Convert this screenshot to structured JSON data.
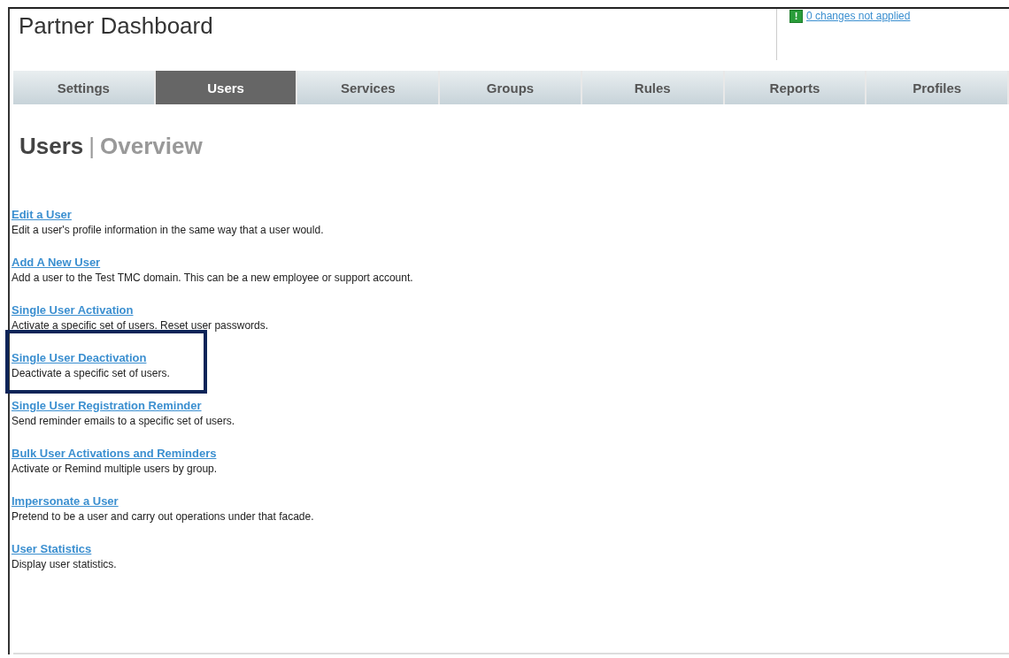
{
  "header": {
    "title": "Partner Dashboard",
    "changes_link": "0 changes not applied",
    "warning_icon": "!"
  },
  "tabs": [
    {
      "label": "Settings",
      "selected": false
    },
    {
      "label": "Users",
      "selected": true
    },
    {
      "label": "Services",
      "selected": false
    },
    {
      "label": "Groups",
      "selected": false
    },
    {
      "label": "Rules",
      "selected": false
    },
    {
      "label": "Reports",
      "selected": false
    },
    {
      "label": "Profiles",
      "selected": false
    }
  ],
  "heading": {
    "section": "Users",
    "separator": "|",
    "page": "Overview"
  },
  "items": [
    {
      "link": "Edit a User",
      "description": "Edit a user's profile information in the same way that a user would.",
      "highlighted": false
    },
    {
      "link": "Add A New User",
      "description": "Add a user to the Test TMC domain. This can be a new employee or support account.",
      "highlighted": false
    },
    {
      "link": "Single User Activation",
      "description": "Activate a specific set of users. Reset user passwords.",
      "highlighted": false
    },
    {
      "link": "Single User Deactivation",
      "description": "Deactivate a specific set of users.",
      "highlighted": true
    },
    {
      "link": "Single User Registration Reminder",
      "description": "Send reminder emails to a specific set of users.",
      "highlighted": false
    },
    {
      "link": "Bulk User Activations and Reminders",
      "description": "Activate or Remind multiple users by group.",
      "highlighted": false
    },
    {
      "link": "Impersonate a User",
      "description": "Pretend to be a user and carry out operations under that facade.",
      "highlighted": false
    },
    {
      "link": "User Statistics",
      "description": "Display user statistics.",
      "highlighted": false
    }
  ]
}
